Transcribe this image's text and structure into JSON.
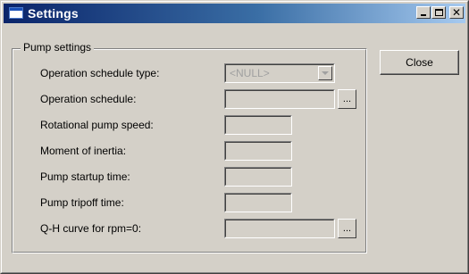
{
  "window": {
    "title": "Settings",
    "controls": {
      "minimize": "minimize-icon",
      "maximize": "maximize-icon",
      "close_glyph": "✕"
    }
  },
  "group": {
    "title": "Pump settings"
  },
  "fields": [
    {
      "label": "Operation schedule type:",
      "kind": "combo",
      "value": "<NULL>",
      "enabled": false
    },
    {
      "label": "Operation schedule:",
      "kind": "text-with-browse",
      "value": "",
      "browse_label": "..."
    },
    {
      "label": "Rotational pump speed:",
      "kind": "text",
      "value": ""
    },
    {
      "label": "Moment of inertia:",
      "kind": "text",
      "value": ""
    },
    {
      "label": "Pump startup time:",
      "kind": "text",
      "value": ""
    },
    {
      "label": "Pump tripoff time:",
      "kind": "text",
      "value": ""
    },
    {
      "label": "Q-H curve for rpm=0:",
      "kind": "text-with-browse",
      "value": "",
      "browse_label": "..."
    }
  ],
  "buttons": {
    "close_label": "Close"
  },
  "colors": {
    "title_bar_start": "#0a246a",
    "title_bar_end": "#a6caf0",
    "face": "#d4d0c8"
  }
}
